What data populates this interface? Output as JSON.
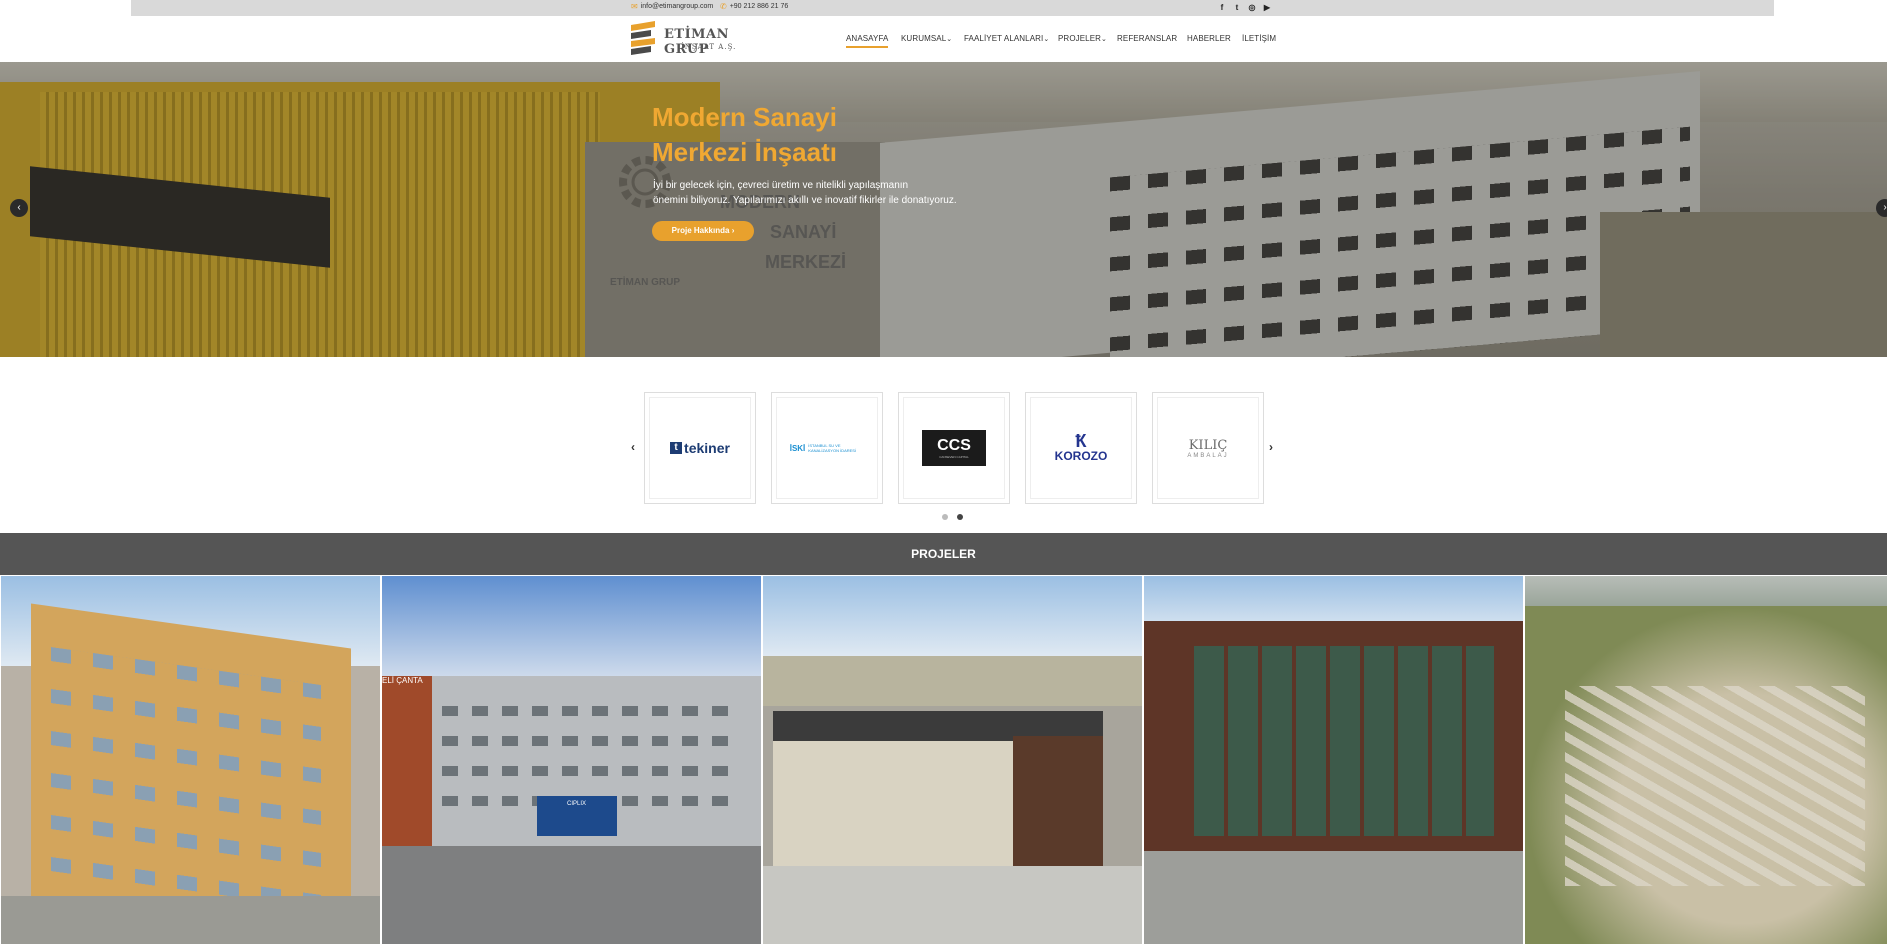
{
  "topbar": {
    "email": "info@etimangroup.com",
    "phone": "+90 212 886 21 76",
    "social": [
      "facebook-icon",
      "twitter-icon",
      "instagram-icon",
      "youtube-icon"
    ]
  },
  "header": {
    "logo_name": "ETİMAN GRUP",
    "logo_sub": "İNŞAAT A.Ş.",
    "nav": [
      {
        "label": "ANASAYFA",
        "dropdown": false,
        "active": true
      },
      {
        "label": "KURUMSAL",
        "dropdown": true
      },
      {
        "label": "FAALİYET ALANLARI",
        "dropdown": true
      },
      {
        "label": "PROJELER",
        "dropdown": true
      },
      {
        "label": "REFERANSLAR",
        "dropdown": false
      },
      {
        "label": "HABERLER",
        "dropdown": false
      },
      {
        "label": "İLETİŞİM",
        "dropdown": false
      }
    ]
  },
  "hero": {
    "title_line1": "Modern Sanayi",
    "title_line2": "Merkezi İnşaatı",
    "desc_line1": "İyi bir gelecek için, çevreci üretim ve nitelikli yapılaşmanın",
    "desc_line2": "önemini biliyoruz. Yapılarımızı akıllı ve inovatif fikirler ile donatıyoruz.",
    "button": "Proje Hakkında",
    "watermark_1": "MODERN",
    "watermark_2": "SANAYİ",
    "watermark_3": "MERKEZİ",
    "watermark_brand": "ETİMAN GRUP"
  },
  "clients": {
    "logos": [
      {
        "name": "tekiner"
      },
      {
        "name": "İSKİ",
        "sub": "İSTANBUL SU VE KANALİZASYON İDARESİ"
      },
      {
        "name": "CCS",
        "sub": "CANSEVEN CAPITAL"
      },
      {
        "name": "KOROZO"
      },
      {
        "name": "KILIÇ",
        "sub": "AMBALAJ"
      }
    ],
    "pages": 2,
    "active_page": 2
  },
  "projects": {
    "title": "PROJELER",
    "tile_sign": "ELİ ÇANTA",
    "tile_truck": "CIPLIX"
  },
  "colors": {
    "accent": "#e8a12d",
    "topbar": "#d9d9d9",
    "projects_bar": "#555555"
  }
}
